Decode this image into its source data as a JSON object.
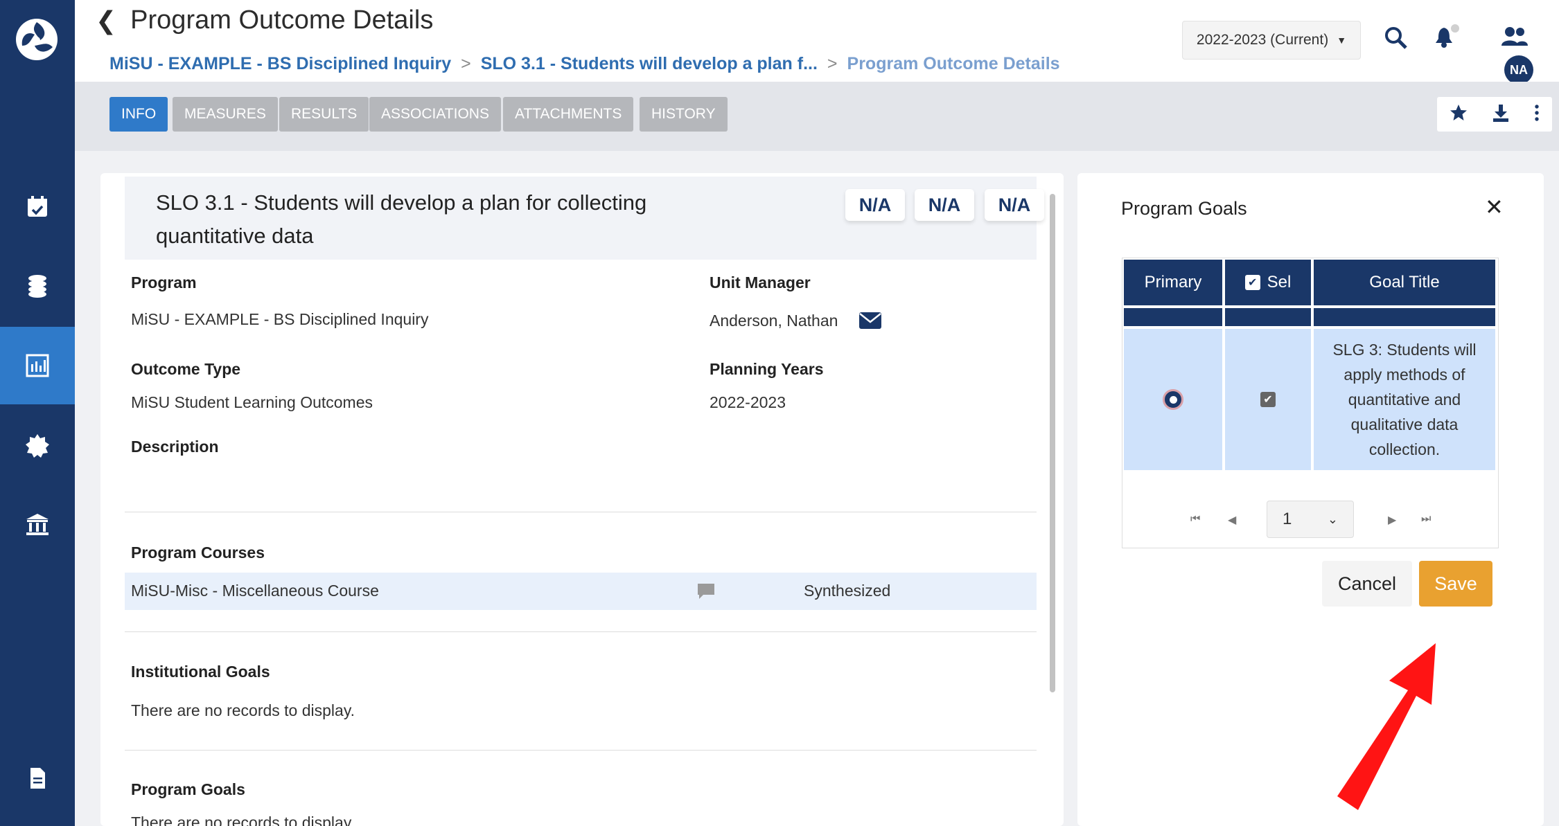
{
  "header": {
    "title": "Program Outcome Details",
    "breadcrumb": [
      "MiSU - EXAMPLE - BS Disciplined Inquiry",
      "SLO 3.1 - Students will develop a plan f...",
      "Program Outcome Details"
    ],
    "year_select": "2022-2023 (Current)",
    "avatar_initials": "NA"
  },
  "tabs": [
    "INFO",
    "MEASURES",
    "RESULTS",
    "ASSOCIATIONS",
    "ATTACHMENTS",
    "HISTORY"
  ],
  "outcome": {
    "title": "SLO 3.1 - Students will develop a plan for collecting quantitative data",
    "badges": [
      "N/A",
      "N/A",
      "N/A"
    ],
    "program_label": "Program",
    "program_value": "MiSU - EXAMPLE - BS Disciplined Inquiry",
    "unit_manager_label": "Unit Manager",
    "unit_manager_value": "Anderson, Nathan",
    "outcome_type_label": "Outcome Type",
    "outcome_type_value": "MiSU Student Learning Outcomes",
    "planning_years_label": "Planning Years",
    "planning_years_value": "2022-2023",
    "description_label": "Description",
    "program_courses_label": "Program Courses",
    "course_name": "MiSU-Misc - Miscellaneous Course",
    "course_status": "Synthesized",
    "institutional_goals_label": "Institutional Goals",
    "institutional_goals_empty": "There are no records to display.",
    "program_goals_label": "Program Goals",
    "program_goals_empty": "There are no records to display."
  },
  "goals_panel": {
    "title": "Program Goals",
    "columns": [
      "Primary",
      "Sel",
      "Goal Title"
    ],
    "rows": [
      {
        "goal_title": "SLG 3: Students will apply methods of quantitative and qualitative data collection.",
        "primary": true,
        "selected": true
      }
    ],
    "page": "1",
    "cancel_label": "Cancel",
    "save_label": "Save"
  },
  "colors": {
    "sidebar": "#1a3768",
    "accent": "#2f7ac9",
    "save": "#e9a130",
    "arrow": "#ff0000"
  }
}
